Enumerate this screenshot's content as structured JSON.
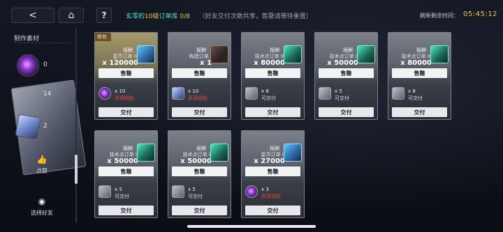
{
  "topbar": {
    "back_glyph": "<",
    "home_glyph": "⌂",
    "help_glyph": "?",
    "title_prefix": "玄零的",
    "title_level": "10级",
    "title_suffix": "订单库",
    "title_count": "0/8",
    "note": "（好友交付次数共享，售罄请等待重置）",
    "refresh_label": "刷新剩余时间：",
    "refresh_time": "05:45:12"
  },
  "sidebar": {
    "header": "制作素材",
    "materials": [
      {
        "icon": "purple-orb-icon",
        "count": "0"
      },
      {
        "icon": "silver-card-icon",
        "count": "14"
      },
      {
        "icon": "crystal-cube-icon",
        "count": "2"
      }
    ],
    "like_label": "点赞",
    "like_icon": "thumbs-up-icon",
    "friend_label": "选择好友",
    "friend_icon": "friend-select-icon"
  },
  "cards": [
    {
      "tag": "稀有",
      "reward_label": "报酬",
      "reward_name": "星币订单 III",
      "reward_amount": "x 120000",
      "sell_label": "售罄",
      "cost_qty": "x 10",
      "cost_status": "资源短缺",
      "status_short": true,
      "deliver_label": "交付"
    },
    {
      "tag": "",
      "reward_label": "报酬",
      "reward_name": "构建订单 I",
      "reward_amount": "x 1",
      "sell_label": "售罄",
      "cost_qty": "x 10",
      "cost_status": "资源短缺",
      "status_short": true,
      "deliver_label": "交付"
    },
    {
      "tag": "",
      "reward_label": "报酬",
      "reward_name": "技术点订单 III",
      "reward_amount": "x 80000",
      "sell_label": "售罄",
      "cost_qty": "x 8",
      "cost_status": "可交付",
      "status_short": false,
      "deliver_label": "交付"
    },
    {
      "tag": "",
      "reward_label": "报酬",
      "reward_name": "技术点订单 II",
      "reward_amount": "x 50000",
      "sell_label": "售罄",
      "cost_qty": "x 5",
      "cost_status": "可交付",
      "status_short": false,
      "deliver_label": "交付"
    },
    {
      "tag": "",
      "reward_label": "报酬",
      "reward_name": "技术点订单 III",
      "reward_amount": "x 80000",
      "sell_label": "售罄",
      "cost_qty": "x 8",
      "cost_status": "可交付",
      "status_short": false,
      "deliver_label": "交付"
    },
    {
      "tag": "",
      "reward_label": "报酬",
      "reward_name": "技术点订单 II",
      "reward_amount": "x 50000",
      "sell_label": "售罄",
      "cost_qty": "x 5",
      "cost_status": "可交付",
      "status_short": false,
      "deliver_label": "交付"
    },
    {
      "tag": "",
      "reward_label": "报酬",
      "reward_name": "技术点订单 II",
      "reward_amount": "x 50000",
      "sell_label": "售罄",
      "cost_qty": "x 5",
      "cost_status": "可交付",
      "status_short": false,
      "deliver_label": "交付"
    },
    {
      "tag": "",
      "reward_label": "报酬",
      "reward_name": "星币订单 II",
      "reward_amount": "x 27000",
      "sell_label": "售罄",
      "cost_qty": "x 3",
      "cost_status": "资源短缺",
      "status_short": true,
      "deliver_label": "交付"
    }
  ],
  "colors": {
    "accent_teal": "#4de0d0",
    "accent_gold": "#f3c54a",
    "warning_red": "#e0473f"
  }
}
